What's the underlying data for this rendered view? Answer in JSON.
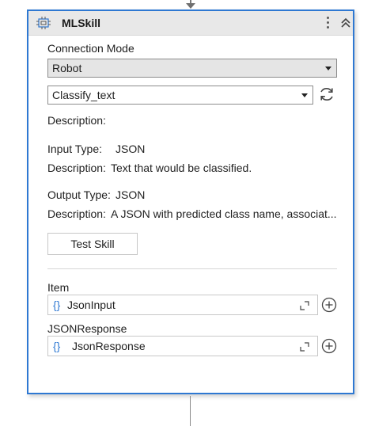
{
  "activity": {
    "title": "MLSkill",
    "icons": {
      "type": "ml-skill-icon",
      "menu": "kebab-menu-icon",
      "collapse": "double-chevron-up-icon"
    }
  },
  "connection_mode": {
    "label": "Connection Mode",
    "selected": "Robot"
  },
  "skill": {
    "selected": "Classify_text",
    "refresh_icon": "refresh-icon"
  },
  "description_label": "Description:",
  "input": {
    "type_label": "Input Type:",
    "type_value": "JSON",
    "desc_label": "Description:",
    "desc_value": "Text that would be classified."
  },
  "output": {
    "type_label": "Output Type:",
    "type_value": "JSON",
    "desc_label": "Description:",
    "desc_value": "A JSON with predicted class name, associat..."
  },
  "test_button": "Test Skill",
  "arguments": [
    {
      "label": "Item",
      "value": "JsonInput",
      "braces": "{}"
    },
    {
      "label": "JSONResponse",
      "value": "JsonResponse",
      "braces": "{}"
    }
  ],
  "colors": {
    "accent": "#2e78d2",
    "header_bg": "#e8e8e8",
    "select_bg": "#e5e5e5"
  }
}
